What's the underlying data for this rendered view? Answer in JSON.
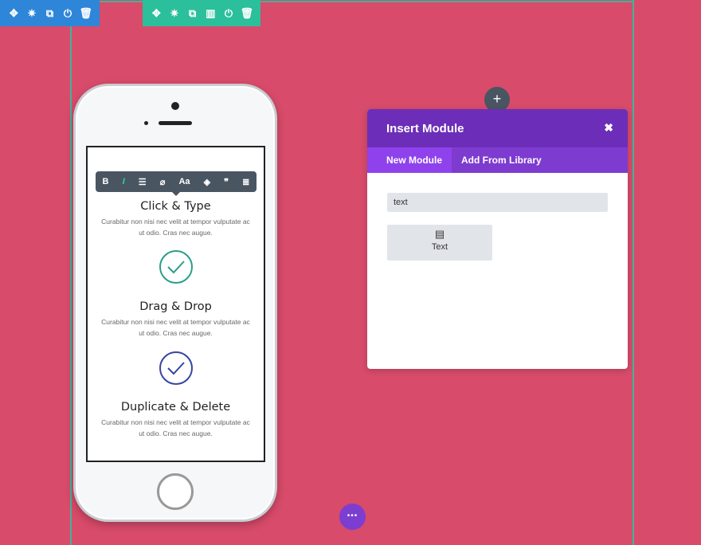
{
  "section_toolbar": {
    "icons": [
      "move-icon",
      "gear-icon",
      "duplicate-icon",
      "power-icon",
      "trash-icon"
    ],
    "color": "#2e86d9"
  },
  "row_toolbar": {
    "icons": [
      "move-icon",
      "gear-icon",
      "duplicate-icon",
      "columns-icon",
      "power-icon",
      "trash-icon"
    ],
    "color": "#2bbf9b"
  },
  "text_toolbar": {
    "bold": "B",
    "italic": "I",
    "align": "☰",
    "link": "⌀",
    "font": "Aa",
    "color": "◈",
    "quote": "❞",
    "list": "≣"
  },
  "features": [
    {
      "title": "Click & Type",
      "text": "Curabitur non nisi nec velit at tempor vulputate ac ut odio. Cras nec augue."
    },
    {
      "title": "Drag & Drop",
      "text": "Curabitur non nisi nec velit at tempor vulputate ac ut odio. Cras nec augue.",
      "check_color": "#2a9d8a"
    },
    {
      "title": "Duplicate & Delete",
      "text": "Curabitur non nisi nec velit at tempor vulputate ac ut odio. Cras nec augue.",
      "check_color": "#3545a0"
    }
  ],
  "modal": {
    "title": "Insert Module",
    "close": "✖",
    "tabs": [
      "New Module",
      "Add From Library"
    ],
    "search_value": "text",
    "module_label": "Text",
    "add_icon": "+",
    "more_icon": "•••"
  }
}
